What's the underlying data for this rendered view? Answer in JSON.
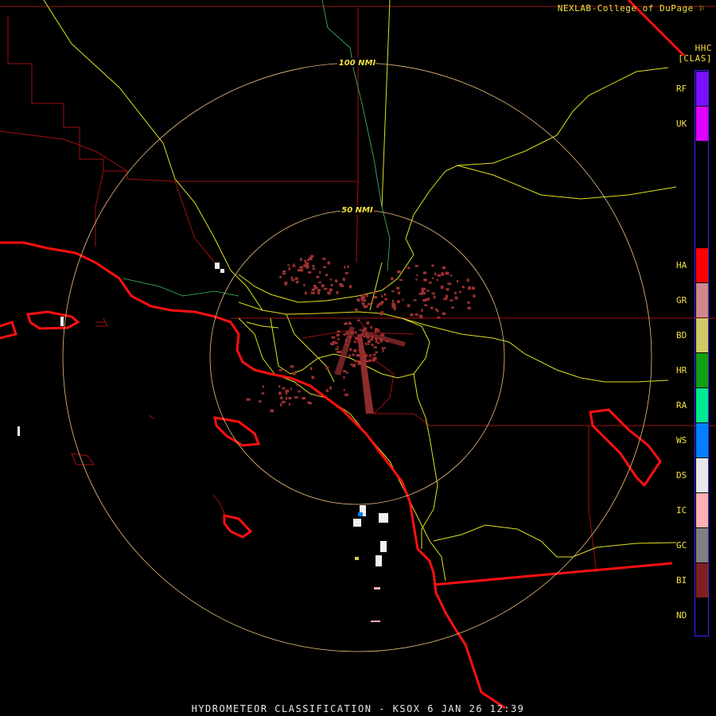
{
  "header": {
    "credit": "NEXLAB-College of DuPage",
    "product_code": "HHC",
    "product_class": "[CLAS]"
  },
  "range_rings": {
    "outer_label": "100 NMI",
    "inner_label": "50 NMI"
  },
  "legend": {
    "items": [
      {
        "code": "RF",
        "color": "#7a10ff"
      },
      {
        "code": "UK",
        "color": "#e000ff"
      },
      {
        "code": "HA",
        "color": "#ff0000"
      },
      {
        "code": "GR",
        "color": "#d08888"
      },
      {
        "code": "BD",
        "color": "#d0c860"
      },
      {
        "code": "HR",
        "color": "#10a010"
      },
      {
        "code": "RA",
        "color": "#00e890"
      },
      {
        "code": "WS",
        "color": "#0080ff"
      },
      {
        "code": "DS",
        "color": "#e8e8e8"
      },
      {
        "code": "IC",
        "color": "#ffb0b0"
      },
      {
        "code": "GC",
        "color": "#808080"
      },
      {
        "code": "BI",
        "color": "#802020"
      },
      {
        "code": "ND",
        "color": "#000000"
      }
    ]
  },
  "footer": {
    "title": "HYDROMETEOR CLASSIFICATION - KSOX 6 JAN 26 12:39"
  },
  "colors": {
    "coast": "#ff1010",
    "county": "#a01010",
    "highway": "#e0e020",
    "river": "#40c060",
    "ring": "#f0c080",
    "echo": "#a03030"
  }
}
